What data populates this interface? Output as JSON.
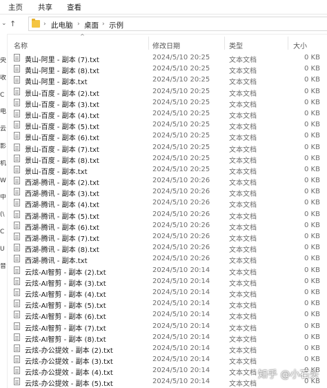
{
  "ribbon": {
    "tabs": [
      "主页",
      "共享",
      "查看"
    ]
  },
  "breadcrumb": [
    "此电脑",
    "桌面",
    "示例"
  ],
  "sidebar_chars": [
    "央",
    "",
    "收",
    "",
    "C",
    "",
    "电",
    "",
    "云",
    "",
    "影",
    "",
    "机",
    "",
    "W",
    "",
    "中",
    "",
    "(\\",
    "",
    "C",
    "",
    "U",
    "",
    "音"
  ],
  "columns": {
    "name": "名称",
    "date": "修改日期",
    "type": "类型",
    "size": "大小"
  },
  "files": [
    {
      "name": "黄山-阿里 - 副本 (7).txt",
      "date": "2024/5/10 20:25",
      "type": "文本文档",
      "size": "0 KB"
    },
    {
      "name": "黄山-阿里 - 副本 (8).txt",
      "date": "2024/5/10 20:25",
      "type": "文本文档",
      "size": "0 KB"
    },
    {
      "name": "黄山-阿里 - 副本.txt",
      "date": "2024/5/10 20:25",
      "type": "文本文档",
      "size": "0 KB"
    },
    {
      "name": "景山-百度 - 副本 (2).txt",
      "date": "2024/5/10 20:25",
      "type": "文本文档",
      "size": "0 KB"
    },
    {
      "name": "景山-百度 - 副本 (3).txt",
      "date": "2024/5/10 20:25",
      "type": "文本文档",
      "size": "0 KB"
    },
    {
      "name": "景山-百度 - 副本 (4).txt",
      "date": "2024/5/10 20:25",
      "type": "文本文档",
      "size": "0 KB"
    },
    {
      "name": "景山-百度 - 副本 (5).txt",
      "date": "2024/5/10 20:25",
      "type": "文本文档",
      "size": "0 KB"
    },
    {
      "name": "景山-百度 - 副本 (6).txt",
      "date": "2024/5/10 20:25",
      "type": "文本文档",
      "size": "0 KB"
    },
    {
      "name": "景山-百度 - 副本 (7).txt",
      "date": "2024/5/10 20:25",
      "type": "文本文档",
      "size": "0 KB"
    },
    {
      "name": "景山-百度 - 副本 (8).txt",
      "date": "2024/5/10 20:25",
      "type": "文本文档",
      "size": "0 KB"
    },
    {
      "name": "景山-百度 - 副本.txt",
      "date": "2024/5/10 20:25",
      "type": "文本文档",
      "size": "0 KB"
    },
    {
      "name": "西湖-腾讯 - 副本 (2).txt",
      "date": "2024/5/10 20:26",
      "type": "文本文档",
      "size": "0 KB"
    },
    {
      "name": "西湖-腾讯 - 副本 (3).txt",
      "date": "2024/5/10 20:26",
      "type": "文本文档",
      "size": "0 KB"
    },
    {
      "name": "西湖-腾讯 - 副本 (4).txt",
      "date": "2024/5/10 20:26",
      "type": "文本文档",
      "size": "0 KB"
    },
    {
      "name": "西湖-腾讯 - 副本 (5).txt",
      "date": "2024/5/10 20:26",
      "type": "文本文档",
      "size": "0 KB"
    },
    {
      "name": "西湖-腾讯 - 副本 (6).txt",
      "date": "2024/5/10 20:26",
      "type": "文本文档",
      "size": "0 KB"
    },
    {
      "name": "西湖-腾讯 - 副本 (7).txt",
      "date": "2024/5/10 20:26",
      "type": "文本文档",
      "size": "0 KB"
    },
    {
      "name": "西湖-腾讯 - 副本 (8).txt",
      "date": "2024/5/10 20:26",
      "type": "文本文档",
      "size": "0 KB"
    },
    {
      "name": "西湖-腾讯 - 副本.txt",
      "date": "2024/5/10 20:26",
      "type": "文本文档",
      "size": "0 KB"
    },
    {
      "name": "云炫-AI智剪 - 副本 (2).txt",
      "date": "2024/5/10 20:14",
      "type": "文本文档",
      "size": "0 KB"
    },
    {
      "name": "云炫-AI智剪 - 副本 (3).txt",
      "date": "2024/5/10 20:14",
      "type": "文本文档",
      "size": "0 KB"
    },
    {
      "name": "云炫-AI智剪 - 副本 (4).txt",
      "date": "2024/5/10 20:14",
      "type": "文本文档",
      "size": "0 KB"
    },
    {
      "name": "云炫-AI智剪 - 副本 (5).txt",
      "date": "2024/5/10 20:14",
      "type": "文本文档",
      "size": "0 KB"
    },
    {
      "name": "云炫-AI智剪 - 副本 (6).txt",
      "date": "2024/5/10 20:14",
      "type": "文本文档",
      "size": "0 KB"
    },
    {
      "name": "云炫-AI智剪 - 副本 (7).txt",
      "date": "2024/5/10 20:14",
      "type": "文本文档",
      "size": "0 KB"
    },
    {
      "name": "云炫-AI智剪 - 副本 (8).txt",
      "date": "2024/5/10 20:14",
      "type": "文本文档",
      "size": "0 KB"
    },
    {
      "name": "云炫-办公提效 - 副本 (2).txt",
      "date": "2024/5/10 20:14",
      "type": "文本文档",
      "size": "0 KB"
    },
    {
      "name": "云炫-办公提效 - 副本 (3).txt",
      "date": "2024/5/10 20:14",
      "type": "文本文档",
      "size": "0 KB"
    },
    {
      "name": "云炫-办公提效 - 副本 (4).txt",
      "date": "2024/5/10 20:14",
      "type": "文本文档",
      "size": "0 KB"
    },
    {
      "name": "云炫-办公提效 - 副本 (5).txt",
      "date": "2024/5/10 20:14",
      "type": "文本文档",
      "size": "0 KB"
    }
  ],
  "watermark": "知乎 @小石头"
}
